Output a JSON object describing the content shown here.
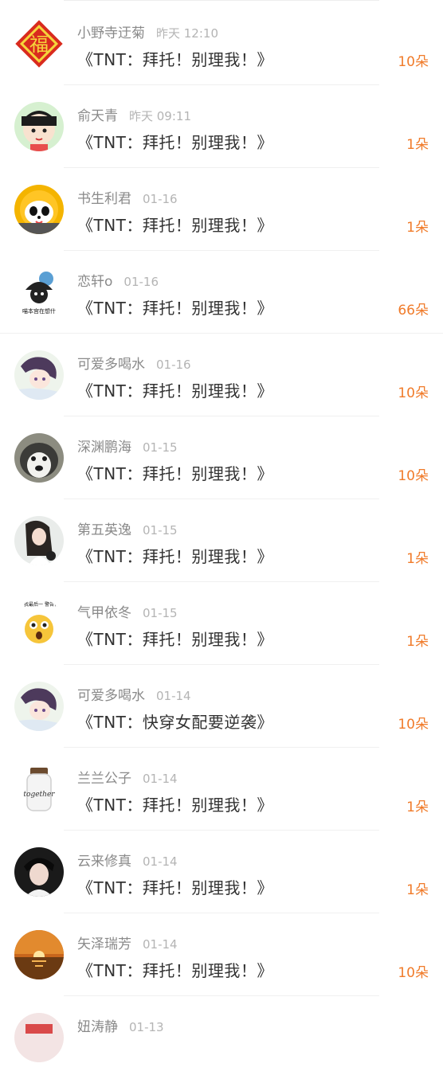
{
  "gifts": [
    {
      "name": "小野寺迂菊",
      "time": "昨天 12:10",
      "title": "《TNT：拜托！别理我！》",
      "amount": "10朵",
      "avatar": "fu-icon"
    },
    {
      "name": "俞天青",
      "time": "昨天 09:11",
      "title": "《TNT：拜托！别理我！》",
      "amount": "1朵",
      "avatar": "cartoon-girl-icon"
    },
    {
      "name": "书生利君",
      "time": "01-16",
      "title": "《TNT：拜托！别理我！》",
      "amount": "1朵",
      "avatar": "panda-icon"
    },
    {
      "name": "恋轩o",
      "time": "01-16",
      "title": "《TNT：拜托！别理我！》",
      "amount": "66朵",
      "avatar": "meme-icon",
      "avatar_text": "喵本宫在想什"
    },
    {
      "name": "可爱多喝水",
      "time": "01-16",
      "title": "《TNT：拜托！别理我！》",
      "amount": "10朵",
      "avatar": "anime-girl-icon"
    },
    {
      "name": "深渊鹏海",
      "time": "01-15",
      "title": "《TNT：拜托！别理我！》",
      "amount": "10朵",
      "avatar": "husky-icon"
    },
    {
      "name": "第五英逸",
      "time": "01-15",
      "title": "《TNT：拜托！别理我！》",
      "amount": "1朵",
      "avatar": "girl-photo-icon"
    },
    {
      "name": "气甲依冬",
      "time": "01-15",
      "title": "《TNT：拜托！别理我！》",
      "amount": "1朵",
      "avatar": "emoji-icon",
      "avatar_text": "食，我最后一 警告你！"
    },
    {
      "name": "可爱多喝水",
      "time": "01-14",
      "title": "《TNT：快穿女配要逆袭》",
      "amount": "10朵",
      "avatar": "anime-girl-icon"
    },
    {
      "name": "兰兰公子",
      "time": "01-14",
      "title": "《TNT：拜托！别理我！》",
      "amount": "1朵",
      "avatar": "jar-icon",
      "avatar_text": "together"
    },
    {
      "name": "云来修真",
      "time": "01-14",
      "title": "《TNT：拜托！别理我！》",
      "amount": "1朵",
      "avatar": "boy-photo-icon"
    },
    {
      "name": "矢泽瑞芳",
      "time": "01-14",
      "title": "《TNT：拜托！别理我！》",
      "amount": "10朵",
      "avatar": "sunset-icon"
    },
    {
      "name": "妞涛静",
      "time": "01-13",
      "title": "",
      "amount": "",
      "avatar": "partial-avatar-icon"
    }
  ]
}
